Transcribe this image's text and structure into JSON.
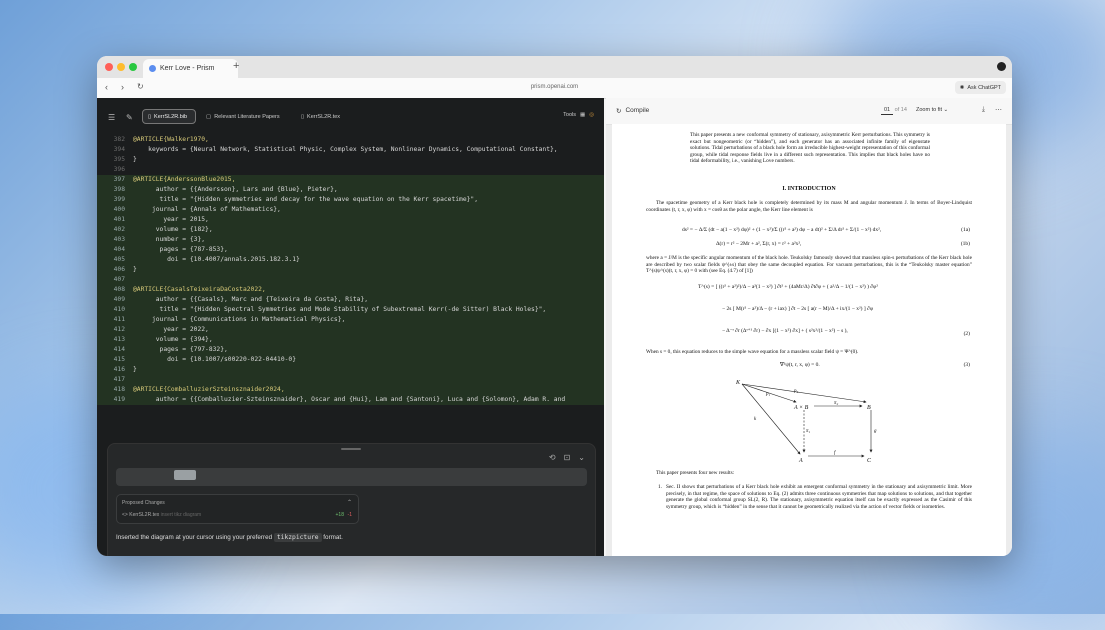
{
  "browser": {
    "tab_title": "Kerr Love - Prism",
    "new_tab": "+",
    "url": "prism.openai.com",
    "ask_button": "Ask ChatGPT"
  },
  "editor": {
    "files": [
      "KerrSL2R.bib",
      "Relevant Literature Papers",
      "KerrSL2R.tex"
    ],
    "tools_label": "Tools",
    "lines": [
      {
        "n": "382",
        "t": "@ARTICLE{Walker1970,",
        "hl": false
      },
      {
        "n": "394",
        "t": "    keywords = {Neural Network, Statistical Physic, Complex System, Nonlinear Dynamics, Computational Constant},",
        "hl": false
      },
      {
        "n": "395",
        "t": "}",
        "hl": false
      },
      {
        "n": "396",
        "t": "",
        "hl": false
      },
      {
        "n": "397",
        "t": "@ARTICLE{AnderssonBlue2015,",
        "hl": true
      },
      {
        "n": "398",
        "t": "      author = {{Andersson}, Lars and {Blue}, Pieter},",
        "hl": true
      },
      {
        "n": "399",
        "t": "       title = \"{Hidden symmetries and decay for the wave equation on the Kerr spacetime}\",",
        "hl": true
      },
      {
        "n": "400",
        "t": "     journal = {Annals of Mathematics},",
        "hl": true
      },
      {
        "n": "401",
        "t": "        year = 2015,",
        "hl": true
      },
      {
        "n": "402",
        "t": "      volume = {182},",
        "hl": true
      },
      {
        "n": "403",
        "t": "      number = {3},",
        "hl": true
      },
      {
        "n": "404",
        "t": "       pages = {787-853},",
        "hl": true
      },
      {
        "n": "405",
        "t": "         doi = {10.4007/annals.2015.182.3.1}",
        "hl": true
      },
      {
        "n": "406",
        "t": "}",
        "hl": true
      },
      {
        "n": "407",
        "t": "",
        "hl": true
      },
      {
        "n": "408",
        "t": "@ARTICLE{CasalsTeixeiraDaCosta2022,",
        "hl": true
      },
      {
        "n": "409",
        "t": "      author = {{Casals}, Marc and {Teixeira da Costa}, Rita},",
        "hl": true
      },
      {
        "n": "410",
        "t": "       title = \"{Hidden Spectral Symmetries and Mode Stability of Subextremal Kerr(-de Sitter) Black Holes}\",",
        "hl": true
      },
      {
        "n": "411",
        "t": "     journal = {Communications in Mathematical Physics},",
        "hl": true
      },
      {
        "n": "412",
        "t": "        year = 2022,",
        "hl": true
      },
      {
        "n": "413",
        "t": "      volume = {394},",
        "hl": true
      },
      {
        "n": "414",
        "t": "       pages = {797-832},",
        "hl": true
      },
      {
        "n": "415",
        "t": "         doi = {10.1007/s00220-022-04410-0}",
        "hl": true
      },
      {
        "n": "416",
        "t": "}",
        "hl": true
      },
      {
        "n": "417",
        "t": "",
        "hl": true
      },
      {
        "n": "418",
        "t": "@ARTICLE{ComballuzierSzteinsznaider2024,",
        "hl": true
      },
      {
        "n": "419",
        "t": "      author = {{Comballuzier-Szteinsznaider}, Oscar and {Hui}, Lam and {Santoni}, Luca and {Solomon}, Adam R. and",
        "hl": true
      }
    ]
  },
  "chat": {
    "proposed_title": "Proposed Changes",
    "proposed_file": "KerrSL2R.tex",
    "proposed_desc": "insert tikz diagram",
    "additions": "+18",
    "deletions": "-1",
    "message_before": "Inserted the diagram at your cursor using your preferred ",
    "message_code": "tikzpicture",
    "message_after": " format."
  },
  "pdf": {
    "compile_label": "Compile",
    "page_current": "01",
    "page_total": "of 14",
    "zoom": "Zoom to fit",
    "abstract": "This paper presents a new conformal symmetry of stationary, axisymmetric Kerr perturbations. This symmetry is exact but nongeometric (or “hidden”), and each generator has an associated infinite family of eigenstate solutions. Tidal perturbations of a black hole form an irreducible highest-weight representation of this conformal group, while tidal response fields live in a different such representation. This implies that black holes have no tidal deformability, i.e., vanishing Love numbers.",
    "section_title": "I.  INTRODUCTION",
    "intro_p1": "The spacetime geometry of a Kerr black hole is completely determined by its mass M and angular momentum J. In terms of Boyer-Lindquist coordinates (t, r, x, φ) with x = cosθ as the polar angle, the Kerr line element is",
    "eq1": "ds² = − Δ/Σ (dt − a(1 − x²) dφ)² + (1 − x²)/Σ ((r² + a²) dφ − a dt)² + Σ/Δ dr² + Σ/(1 − x²) dx²,",
    "eq1_num": "(1a)",
    "eq1b": "Δ(r) = r² − 2Mr + a²,      Σ(r, x) = r² + a²x²,",
    "eq1b_num": "(1b)",
    "intro_p2": "where a = J/M is the specific angular momentum of the black hole. Teukolsky famously showed that massless spin-s perturbations of the Kerr black hole are described by two scalar fields ψ^(±s) that obey the same decoupled equation. For vacuum perturbations, this is the “Teukolsky master equation” T^(s)ψ^(s)(t, r, x, φ) = 0 with (see Eq. (4.7) of [1])",
    "eq2a": "T^(s) = [ ((r² + a²)²)/Δ − a²(1 − x²) ] ∂t² + (4aMr/Δ) ∂t∂φ + ( a²/Δ − 1/(1 − x²) ) ∂φ²",
    "eq2b": "− 2s [ M(r² − a²)/Δ − (r + iax) ] ∂t − 2s [ a(r − M)/Δ + ix/(1 − x²) ] ∂φ",
    "eq2c": "− Δ⁻ˢ ∂r (Δˢ⁺¹ ∂r) − ∂x [(1 − x²) ∂x] + ( s²x²/(1 − x²) − s ),",
    "eq2_num": "(2)",
    "intro_p3": "When s = 0, this equation reduces to the simple wave equation for a massless scalar field ψ = Ψ^(0).",
    "eq3": "∇²ψ(t, r, x, φ) = 0.",
    "eq3_num": "(3)",
    "diagram_labels": [
      "K",
      "A × B",
      "B",
      "A",
      "C",
      "p₂",
      "p₁",
      "π₁",
      "π₂",
      "f",
      "g",
      "k"
    ],
    "results_intro": "This paper presents four new results:",
    "result1_num": "1.",
    "result1": "Sec. II shows that perturbations of a Kerr black hole exhibit an emergent conformal symmetry in the stationary and axisymmetric limit. More precisely, in that regime, the space of solutions to Eq. (2) admits three continuous symmetries that map solutions to solutions, and that together generate the global conformal group SL(2, R). The stationary, axisymmetric equation itself can be exactly expressed as the Casimir of this symmetry group, which is “hidden” in the sense that it cannot be geometrically realized via the action of vector fields or isometries."
  },
  "colors": {
    "editor_bg": "#1b1d1e",
    "highlight": "#233322",
    "link_red": "#cc4444",
    "link_blue": "#3a6fc5"
  }
}
